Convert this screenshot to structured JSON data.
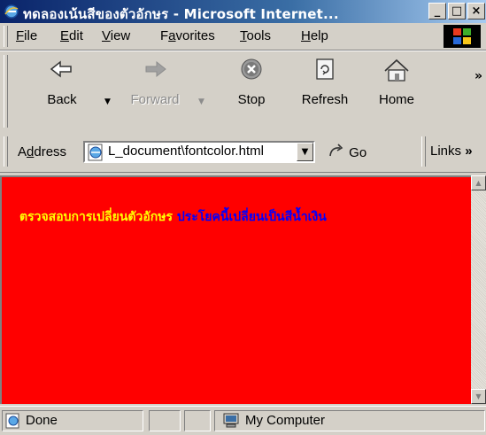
{
  "window": {
    "title": "ทดลองเน้นสีของตัวอักษร - Microsoft Internet...",
    "controls": {
      "minimize": "_",
      "maximize": "□",
      "close": "×"
    }
  },
  "menu": [
    "File",
    "Edit",
    "View",
    "Favorites",
    "Tools",
    "Help"
  ],
  "menu_hotkeys": [
    "F",
    "E",
    "V",
    "a",
    "T",
    "H"
  ],
  "toolbar": [
    {
      "label": "Back",
      "icon": "back-arrow-icon",
      "enabled": true
    },
    {
      "label": "Forward",
      "icon": "forward-arrow-icon",
      "enabled": false
    },
    {
      "label": "Stop",
      "icon": "stop-icon",
      "enabled": true
    },
    {
      "label": "Refresh",
      "icon": "refresh-icon",
      "enabled": true
    },
    {
      "label": "Home",
      "icon": "home-icon",
      "enabled": true
    }
  ],
  "address": {
    "label": "Address",
    "value": "L_document\\fontcolor.html",
    "go": "Go",
    "links": "Links"
  },
  "content": {
    "background": "#ff0000",
    "yellow_text": "ตรวจสอบการเปลี่ยนตัวอักษร",
    "blue_text": "ประโยคนี้เปลี่ยนเป็นสีน้ำเงิน",
    "yellow_color": "#ffff00",
    "blue_color": "#0000ff"
  },
  "status": {
    "text": "Done",
    "zone": "My Computer"
  }
}
